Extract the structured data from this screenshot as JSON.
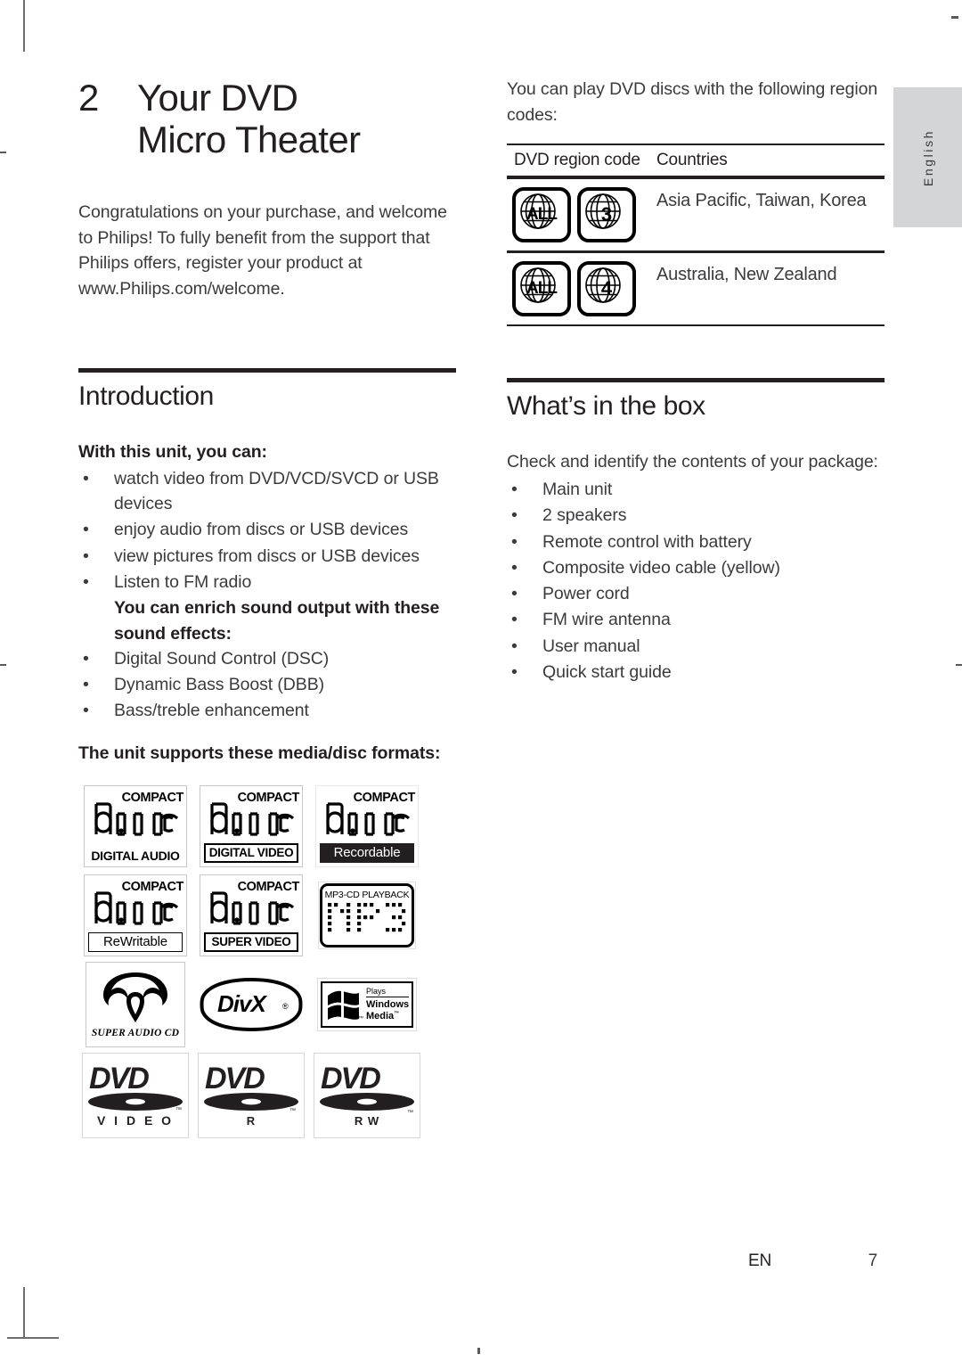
{
  "language_tab": "English",
  "chapter": {
    "number": "2",
    "title_line1": "Your DVD",
    "title_line2": "Micro Theater"
  },
  "intro_paragraph": "Congratulations on your purchase, and welcome to Philips! To fully benefit from the support that Philips offers, register your product at www.Philips.com/welcome.",
  "sections": {
    "introduction": {
      "heading": "Introduction",
      "lead": "With this unit, you can:",
      "features": [
        "watch video from DVD/VCD/SVCD or USB devices",
        "enjoy audio from discs or USB devices",
        "view pictures from discs or USB devices",
        "Listen to FM radio"
      ],
      "sound_lead": "You can enrich sound output with these sound effects:",
      "sound_effects": [
        "Digital Sound Control (DSC)",
        "Dynamic Bass Boost (DBB)",
        "Bass/treble enhancement"
      ],
      "formats_lead": "The unit supports these media/disc formats:"
    },
    "whats_in_the_box": {
      "heading": "What’s in the box",
      "lead": "Check and identify the contents of your package:",
      "items": [
        "Main unit",
        "2 speakers",
        "Remote control with battery",
        "Composite video cable (yellow)",
        "Power cord",
        "FM wire antenna",
        "User manual",
        "Quick start guide"
      ]
    }
  },
  "region_codes": {
    "intro": "You can play DVD discs with the following region codes:",
    "columns": [
      "DVD region code",
      "Countries"
    ],
    "rows": [
      {
        "badges": [
          "ALL",
          "3"
        ],
        "countries": "Asia Pacific, Taiwan, Korea"
      },
      {
        "badges": [
          "ALL",
          "4"
        ],
        "countries": "Australia, New Zealand"
      }
    ]
  },
  "disc_logos": [
    {
      "kind": "cd",
      "top": "COMPACT",
      "mid": "disc",
      "band": "DIGITAL AUDIO",
      "band_style": "plain"
    },
    {
      "kind": "cd",
      "top": "COMPACT",
      "mid": "disc",
      "band": "DIGITAL VIDEO",
      "band_style": "boxed"
    },
    {
      "kind": "cd",
      "top": "COMPACT",
      "mid": "disc",
      "band": "Recordable",
      "band_style": "dark"
    },
    {
      "kind": "cd",
      "top": "COMPACT",
      "mid": "disc",
      "band": "ReWritable",
      "band_style": "thinbox"
    },
    {
      "kind": "cd",
      "top": "COMPACT",
      "mid": "disc",
      "band": "SUPER VIDEO",
      "band_style": "boxed"
    },
    {
      "kind": "mp3",
      "caption": "MP3-CD PLAYBACK",
      "word": "MP3"
    },
    {
      "kind": "sacd",
      "caption": "SUPER AUDIO CD"
    },
    {
      "kind": "divx",
      "word": "DivX",
      "mark": "®"
    },
    {
      "kind": "wm",
      "plays": "Plays",
      "line1": "Windows",
      "line2": "Media",
      "tm": "™"
    },
    {
      "kind": "dvd",
      "word": "DVD",
      "sub": "V I D E O",
      "tm": "™"
    },
    {
      "kind": "dvd",
      "word": "DVD",
      "sub": "R",
      "tm": "™"
    },
    {
      "kind": "dvd",
      "word": "DVD",
      "sub": "R W",
      "tm": "™"
    }
  ],
  "footer": {
    "language_code": "EN",
    "page_number": "7"
  }
}
